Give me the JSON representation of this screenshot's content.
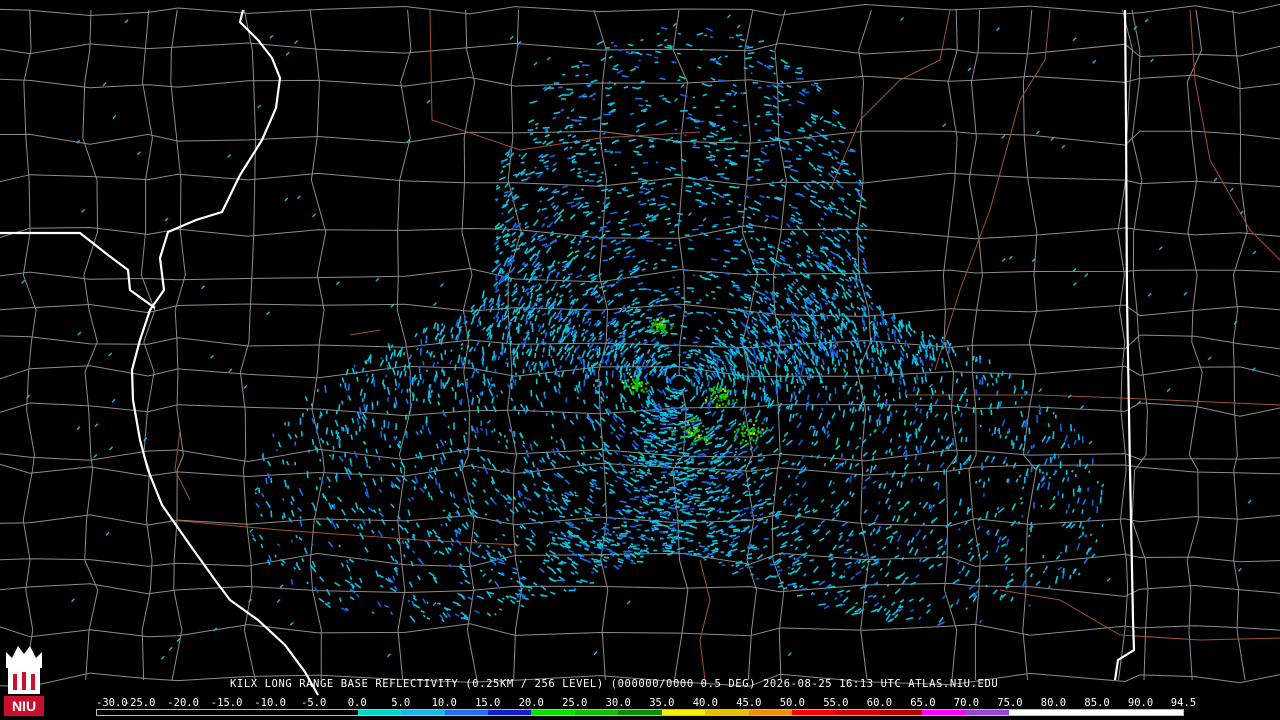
{
  "product_caption": "KILX LONG RANGE BASE REFLECTIVITY (0.25KM / 256 LEVEL) (000000/0000 0.5 DEG) 2026-08-25 16:13 UTC  ATLAS.NIU.EDU",
  "logo_text": "NIU",
  "colors": {
    "background": "#000000",
    "county_lines": "#8c8c8c",
    "state_lines": "#ffffff",
    "highways": "#a0522d",
    "radar_site": "#000000"
  },
  "scale": {
    "labels": [
      "-30.0",
      "-25.0",
      "-20.0",
      "-15.0",
      "-10.0",
      "-5.0",
      "0.0",
      "5.0",
      "10.0",
      "15.0",
      "20.0",
      "25.0",
      "30.0",
      "35.0",
      "40.0",
      "45.0",
      "50.0",
      "55.0",
      "60.0",
      "65.0",
      "70.0",
      "75.0",
      "80.0",
      "85.0",
      "90.0",
      "94.5"
    ],
    "colors": [
      "#000000",
      "#000000",
      "#000000",
      "#000000",
      "#000000",
      "#000000",
      "#00d8c8",
      "#1ab8e8",
      "#2070f0",
      "#1020c8",
      "#08e000",
      "#10c000",
      "#089000",
      "#f0f000",
      "#e8c000",
      "#f09000",
      "#ff0000",
      "#d80000",
      "#b80000",
      "#ff00ff",
      "#9848d0",
      "#ffffff",
      "#ffffff",
      "#ffffff",
      "#ffffff"
    ]
  }
}
